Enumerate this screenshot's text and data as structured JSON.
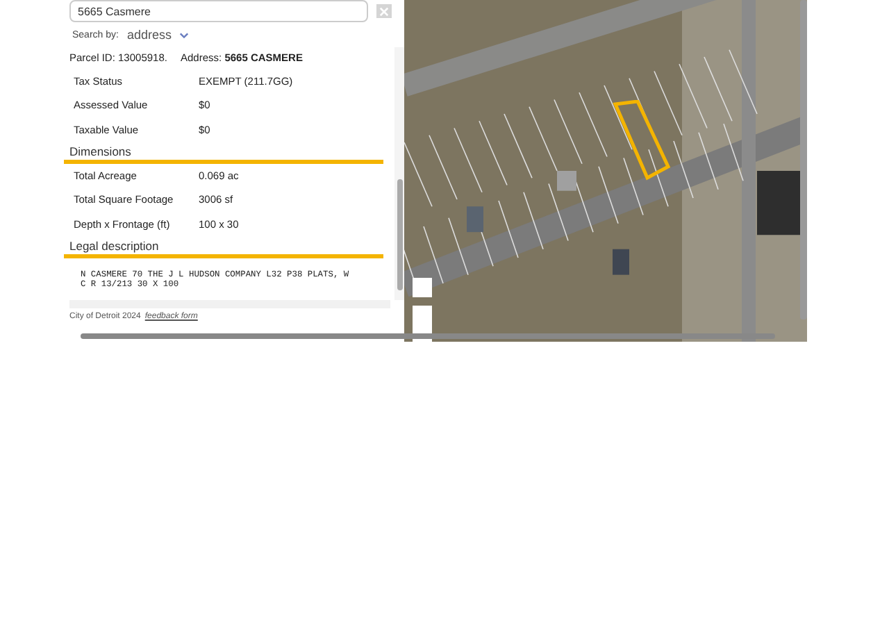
{
  "search": {
    "value": "5665 Casmere"
  },
  "search_by": {
    "label": "Search by:",
    "value": "address"
  },
  "parcel": {
    "id_label": "Parcel ID: 13005918.",
    "address_label": "Address:",
    "address": "5665 CASMERE"
  },
  "summary_rows": [
    {
      "label": "Tax Status",
      "value": "EXEMPT (211.7GG)"
    },
    {
      "label": "Assessed Value",
      "value": "$0"
    },
    {
      "label": "Taxable Value",
      "value": "$0"
    }
  ],
  "dimensions": {
    "title": "Dimensions",
    "rows": [
      {
        "label": "Total Acreage",
        "value": "0.069 ac"
      },
      {
        "label": "Total Square Footage",
        "value": "3006 sf"
      },
      {
        "label": "Depth x Frontage (ft)",
        "value": "100 x 30"
      }
    ]
  },
  "legal": {
    "title": "Legal description",
    "text": "N CASMERE 70 THE J L HUDSON COMPANY L32 P38 PLATS, W\nC R 13/213 30 X 100"
  },
  "footer": {
    "text": "City of Detroit 2024",
    "link": "feedback form"
  }
}
